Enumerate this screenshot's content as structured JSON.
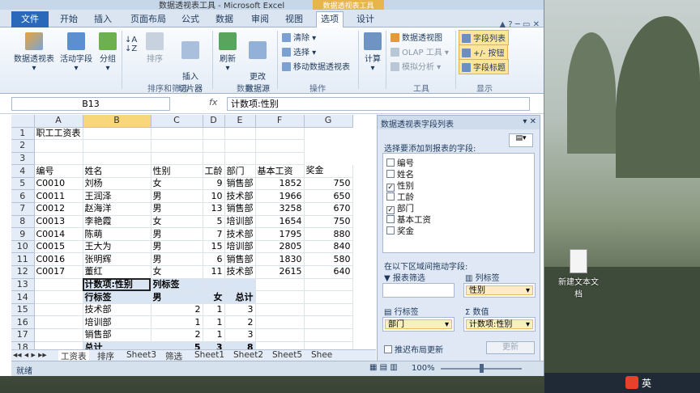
{
  "window": {
    "title": "数据透视表工具 - Microsoft Excel",
    "context_tab": "数据透视表工具"
  },
  "tabs": [
    "文件",
    "开始",
    "插入",
    "页面布局",
    "公式",
    "数据",
    "审阅",
    "视图",
    "选项",
    "设计"
  ],
  "ribbon": {
    "pivot_table": "数据透视表",
    "active_field": "活动字段",
    "group": "分组",
    "sort": "排序",
    "insert_slicer": "插入\n切片器",
    "refresh": "刷新",
    "change_source": "更改\n数据源",
    "clear": "清除",
    "select": "选择",
    "move_pivot": "移动数据透视表",
    "calculate": "计算",
    "pivot_chart": "数据透视图",
    "olap": "OLAP 工具",
    "what_if": "模拟分析",
    "field_list": "字段列表",
    "buttons": "+/- 按钮",
    "field_headers": "字段标题",
    "groups": {
      "sort_filter": "排序和筛选",
      "data": "数据",
      "actions": "操作",
      "tools": "工具",
      "show": "显示"
    }
  },
  "formula_bar": {
    "cell": "B13",
    "fx": "fx",
    "value": "计数项:性别"
  },
  "sheet": {
    "columns": [
      "A",
      "B",
      "C",
      "D",
      "E",
      "F",
      "G"
    ],
    "rows": [
      [
        "1",
        "职工工资表",
        "",
        "",
        "",
        "",
        ""
      ],
      [
        "2",
        "",
        "",
        "",
        "",
        "",
        ""
      ],
      [
        "3",
        "",
        "",
        "",
        "",
        "",
        ""
      ],
      [
        "4",
        "编号",
        "姓名",
        "性别",
        "工龄",
        "部门",
        "基本工资",
        "奖金"
      ],
      [
        "5",
        "C0010",
        "刘杨",
        "女",
        "9",
        "销售部",
        "1852",
        "750"
      ],
      [
        "6",
        "C0011",
        "王润泽",
        "男",
        "10",
        "技术部",
        "1966",
        "650"
      ],
      [
        "7",
        "C0012",
        "赵海洋",
        "男",
        "13",
        "销售部",
        "3258",
        "670"
      ],
      [
        "8",
        "C0013",
        "李艳霞",
        "女",
        "5",
        "培训部",
        "1654",
        "750"
      ],
      [
        "9",
        "C0014",
        "陈萌",
        "男",
        "7",
        "技术部",
        "1795",
        "880"
      ],
      [
        "10",
        "C0015",
        "王大为",
        "男",
        "15",
        "培训部",
        "2805",
        "840"
      ],
      [
        "11",
        "C0016",
        "张明辉",
        "男",
        "6",
        "销售部",
        "1830",
        "580"
      ],
      [
        "12",
        "C0017",
        "董红",
        "女",
        "11",
        "技术部",
        "2615",
        "640"
      ]
    ],
    "pivot": {
      "r13": [
        "13",
        "",
        "计数项:性别",
        "列标签"
      ],
      "r14": [
        "14",
        "",
        "行标签",
        "男",
        "女",
        "总计"
      ],
      "data": [
        [
          "15",
          "技术部",
          "2",
          "1",
          "3"
        ],
        [
          "16",
          "培训部",
          "1",
          "1",
          "2"
        ],
        [
          "17",
          "销售部",
          "2",
          "1",
          "3"
        ],
        [
          "18",
          "总计",
          "5",
          "3",
          "8"
        ]
      ]
    }
  },
  "sheet_tabs": [
    "工资表",
    "排序",
    "Sheet3",
    "筛选",
    "Sheet1",
    "Sheet2",
    "Sheet5",
    "Shee"
  ],
  "status": {
    "ready": "就绪",
    "zoom": "100%"
  },
  "panel": {
    "title": "数据透视表字段列表",
    "choose": "选择要添加到报表的字段:",
    "fields": [
      {
        "name": "编号",
        "checked": false
      },
      {
        "name": "姓名",
        "checked": false
      },
      {
        "name": "性别",
        "checked": true
      },
      {
        "name": "工龄",
        "checked": false
      },
      {
        "name": "部门",
        "checked": true
      },
      {
        "name": "基本工资",
        "checked": false
      },
      {
        "name": "奖金",
        "checked": false
      }
    ],
    "drag_label": "在以下区域间拖动字段:",
    "report_filter": "报表筛选",
    "col_labels": "列标签",
    "col_value": "性别",
    "row_labels": "行标签",
    "row_value": "部门",
    "values": "数值",
    "values_value": "计数项:性别",
    "defer": "推迟布局更新",
    "update": "更新"
  },
  "desktop": {
    "file_label": "新建文本文\n档"
  },
  "tray": {
    "ime": "英"
  },
  "colors": {
    "accent": "#2a68b9",
    "pivot_fill": "#dae5f3",
    "highlight": "#fde69a"
  }
}
